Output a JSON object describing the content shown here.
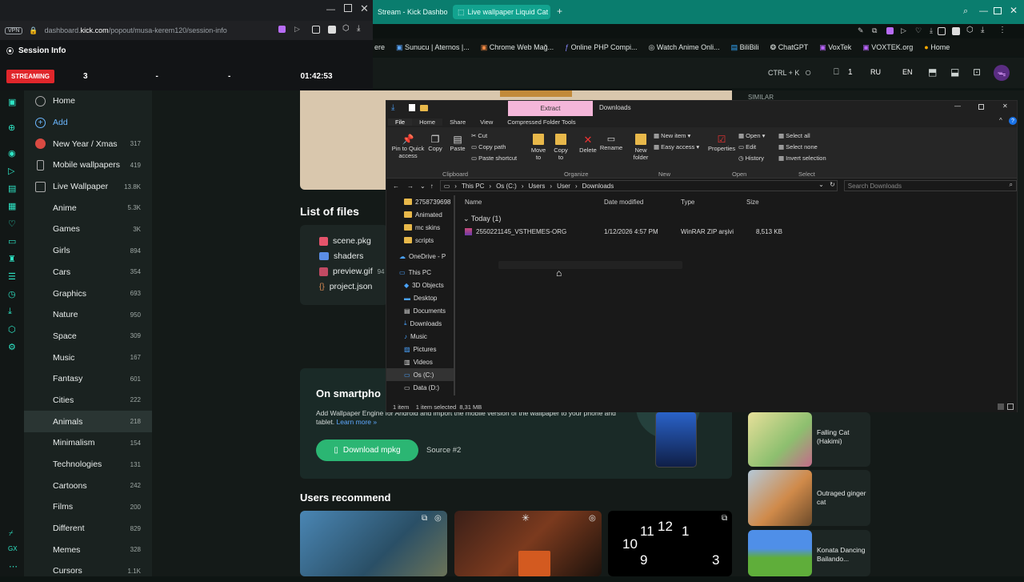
{
  "popup": {
    "vpn": "VPN",
    "url_host": "dashboard.",
    "url_domain": "kick.com",
    "url_path": "/popout/musa-kerem120/session-info",
    "session_title": "Session Info",
    "streaming_badge": "STREAMING",
    "viewers": "3",
    "col2": "-",
    "col3": "-",
    "duration": "01:42:53"
  },
  "tabs": [
    {
      "label": "Stream - Kick Dashbo"
    },
    {
      "label": "Live wallpaper Liquid Cat"
    }
  ],
  "bookmarks": [
    "ere",
    "Sunucu | Aternos |...",
    "Chrome Web Mağ...",
    "Online PHP Compi...",
    "Watch Anime Onli...",
    "BiliBili",
    "ChatGPT",
    "VoxTek",
    "VOXTEK.org",
    "Home"
  ],
  "header": {
    "shortcut": "CTRL + K",
    "notif_count": "1",
    "lang1": "RU",
    "lang2": "EN"
  },
  "sidebar": {
    "items": [
      {
        "label": "Home",
        "count": ""
      },
      {
        "label": "Add",
        "count": ""
      },
      {
        "label": "New Year / Xmas",
        "count": "317"
      },
      {
        "label": "Mobile wallpapers",
        "count": "419"
      },
      {
        "label": "Live Wallpaper",
        "count": "13.8K"
      },
      {
        "label": "Anime",
        "count": "5.3K"
      },
      {
        "label": "Games",
        "count": "3K"
      },
      {
        "label": "Girls",
        "count": "894"
      },
      {
        "label": "Cars",
        "count": "354"
      },
      {
        "label": "Graphics",
        "count": "693"
      },
      {
        "label": "Nature",
        "count": "950"
      },
      {
        "label": "Space",
        "count": "309"
      },
      {
        "label": "Music",
        "count": "167"
      },
      {
        "label": "Fantasy",
        "count": "601"
      },
      {
        "label": "Cities",
        "count": "222"
      },
      {
        "label": "Animals",
        "count": "218"
      },
      {
        "label": "Minimalism",
        "count": "154"
      },
      {
        "label": "Technologies",
        "count": "131"
      },
      {
        "label": "Cartoons",
        "count": "242"
      },
      {
        "label": "Films",
        "count": "200"
      },
      {
        "label": "Different",
        "count": "829"
      },
      {
        "label": "Memes",
        "count": "328"
      },
      {
        "label": "Cursors",
        "count": "1.1K"
      }
    ]
  },
  "files": {
    "title": "List of files",
    "items": [
      "scene.pkg",
      "shaders",
      "preview.gif",
      "project.json"
    ],
    "size_hint": "94"
  },
  "smartphone": {
    "title": "On smartpho",
    "desc": "Add Wallpaper Engine for Android and import the mobile version of the wallpaper to your phone and tablet.",
    "learn_more": "Learn more »",
    "download": "Download mpkg",
    "source": "Source #2"
  },
  "users_recommend": "Users recommend",
  "similar": {
    "heading": "SIMILAR",
    "items": [
      "Falling Cat (Hakimi)",
      "Outraged ginger cat",
      "Konata Dancing Bailando..."
    ]
  },
  "explorer": {
    "tab_extract": "Extract",
    "window_title": "Downloads",
    "ribbon_tabs": [
      "File",
      "Home",
      "Share",
      "View",
      "Compressed Folder Tools"
    ],
    "ribbon": {
      "pin": "Pin to Quick access",
      "copy": "Copy",
      "paste": "Paste",
      "cut": "Cut",
      "copy_path": "Copy path",
      "paste_shortcut": "Paste shortcut",
      "move_to": "Move to",
      "copy_to": "Copy to",
      "delete": "Delete",
      "rename": "Rename",
      "new_folder": "New folder",
      "new_item": "New item",
      "easy_access": "Easy access",
      "properties": "Properties",
      "open": "Open",
      "edit": "Edit",
      "history": "History",
      "select_all": "Select all",
      "select_none": "Select none",
      "invert": "Invert selection",
      "g_clipboard": "Clipboard",
      "g_organize": "Organize",
      "g_new": "New",
      "g_open": "Open",
      "g_select": "Select"
    },
    "breadcrumb": [
      "This PC",
      "Os (C:)",
      "Users",
      "User",
      "Downloads"
    ],
    "search_placeholder": "Search Downloads",
    "tree": [
      "2758739698",
      "Animated",
      "mc skins",
      "scripts",
      "OneDrive - P",
      "This PC",
      "3D Objects",
      "Desktop",
      "Documents",
      "Downloads",
      "Music",
      "Pictures",
      "Videos",
      "Os (C:)",
      "Data (D:)"
    ],
    "columns": [
      "Name",
      "Date modified",
      "Type",
      "Size"
    ],
    "group": "Today (1)",
    "file": {
      "name": "2550221145_VSTHEMES-ORG",
      "date": "1/12/2026 4:57 PM",
      "type": "WinRAR ZIP arşivi",
      "size": "8,513 KB"
    },
    "status": "1 item    1 item selected  8,31 MB"
  },
  "colors": {
    "accent": "#0a7d6e",
    "download_btn": "#2bb673",
    "streaming": "#e0262b"
  }
}
